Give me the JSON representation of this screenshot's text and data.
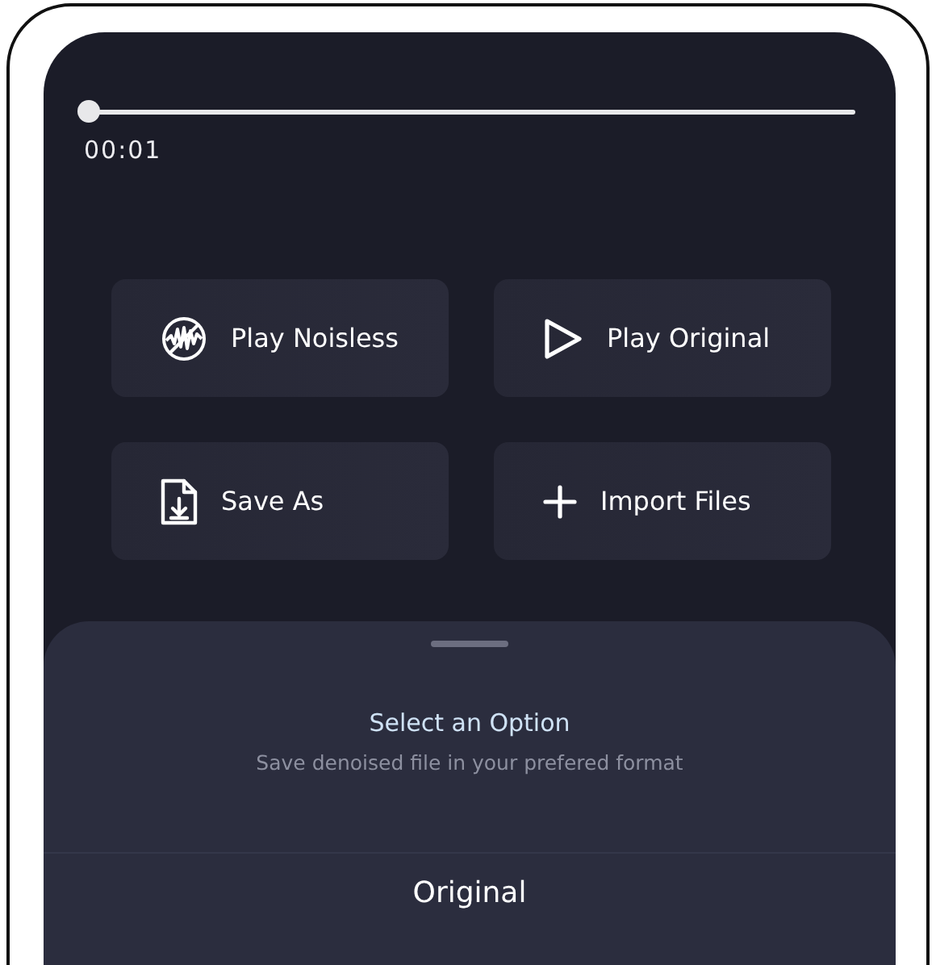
{
  "player": {
    "level": 0,
    "time": "00:01"
  },
  "actions": [
    {
      "kind": "noise",
      "label": "Play Noisless"
    },
    {
      "kind": "play",
      "label": "Play Original"
    },
    {
      "kind": "save",
      "label": "Save As"
    },
    {
      "kind": "add",
      "label": "Import Files"
    }
  ],
  "sheet": {
    "title": "Select an Option",
    "subtitle": "Save denoised file in your prefered format",
    "options": [
      "Original"
    ]
  }
}
